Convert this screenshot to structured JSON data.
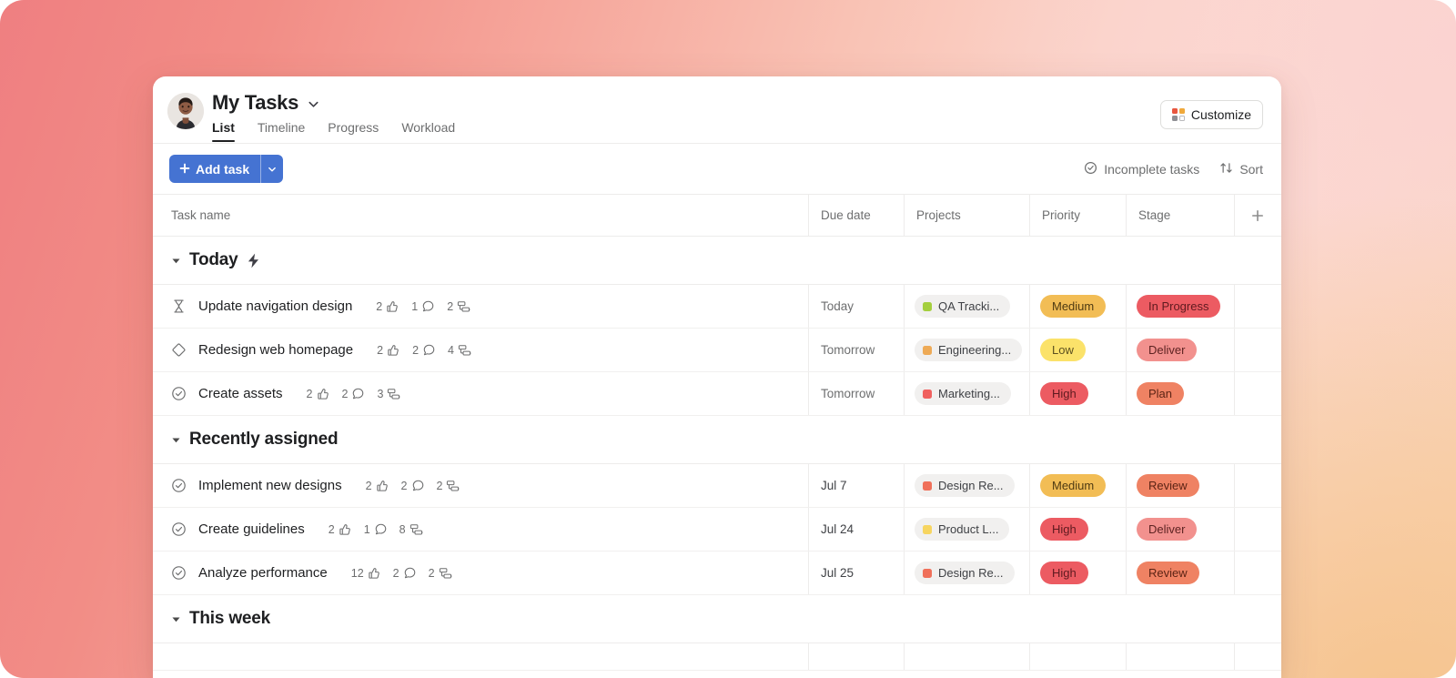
{
  "background": {
    "gradient_from": "#ef7f81",
    "gradient_mid": "#f9c3b5",
    "gradient_to": "#f9d7bd"
  },
  "header": {
    "title": "My Tasks",
    "title_caret_icon": "chevron-down-icon",
    "avatar_icon": "user-avatar",
    "tabs": [
      {
        "label": "List",
        "active": true
      },
      {
        "label": "Timeline",
        "active": false
      },
      {
        "label": "Progress",
        "active": false
      },
      {
        "label": "Workload",
        "active": false
      }
    ],
    "customize": {
      "label": "Customize",
      "icon": "grid-squares-icon",
      "swatches": [
        "#e8563f",
        "#f0a93b",
        "#8f8f94",
        "#ffffff"
      ]
    }
  },
  "toolbar": {
    "add_task_label": "Add task",
    "add_task_plus_icon": "plus-icon",
    "add_task_caret_icon": "chevron-down-icon",
    "add_task_color": "#4573d2",
    "filter": {
      "label": "Incomplete tasks",
      "icon": "check-circle-icon"
    },
    "sort": {
      "label": "Sort",
      "icon": "sort-arrows-icon"
    }
  },
  "table": {
    "columns": [
      {
        "key": "task_name",
        "label": "Task name"
      },
      {
        "key": "due_date",
        "label": "Due date"
      },
      {
        "key": "projects",
        "label": "Projects"
      },
      {
        "key": "priority",
        "label": "Priority"
      },
      {
        "key": "stage",
        "label": "Stage"
      }
    ],
    "add_column_icon": "plus-icon",
    "sections": [
      {
        "title": "Today",
        "caret_icon": "caret-down-icon",
        "badge_icon": "lightning-bolt-icon",
        "tasks": [
          {
            "status_icon": "hourglass-icon",
            "name": "Update navigation design",
            "likes": "2",
            "comments": "1",
            "subtasks": "2",
            "due_date": "Today",
            "due_muted": true,
            "project": {
              "label": "QA Tracki...",
              "color": "#a4cf3e"
            },
            "priority": {
              "label": "Medium",
              "bg": "#f2bd55",
              "fg": "#4e3a12"
            },
            "stage": {
              "label": "In Progress",
              "bg": "#ec5b62",
              "fg": "#5e1a1f"
            }
          },
          {
            "status_icon": "diamond-icon",
            "name": "Redesign web homepage",
            "likes": "2",
            "comments": "2",
            "subtasks": "4",
            "due_date": "Tomorrow",
            "due_muted": true,
            "project": {
              "label": "Engineering...",
              "color": "#eeaa56"
            },
            "priority": {
              "label": "Low",
              "bg": "#fbe26a",
              "fg": "#5c5020"
            },
            "stage": {
              "label": "Deliver",
              "bg": "#f2918e",
              "fg": "#5e2322"
            }
          },
          {
            "status_icon": "check-circle-icon",
            "name": "Create assets",
            "likes": "2",
            "comments": "2",
            "subtasks": "3",
            "due_date": "Tomorrow",
            "due_muted": true,
            "project": {
              "label": "Marketing...",
              "color": "#f0615f"
            },
            "priority": {
              "label": "High",
              "bg": "#ec5b62",
              "fg": "#5e1a1f"
            },
            "stage": {
              "label": "Plan",
              "bg": "#ef8263",
              "fg": "#5c2415"
            }
          }
        ]
      },
      {
        "title": "Recently assigned",
        "caret_icon": "caret-down-icon",
        "badge_icon": "",
        "tasks": [
          {
            "status_icon": "check-circle-icon",
            "name": "Implement new designs",
            "likes": "2",
            "comments": "2",
            "subtasks": "2",
            "due_date": "Jul 7",
            "due_muted": false,
            "project": {
              "label": "Design Re...",
              "color": "#f0705a"
            },
            "priority": {
              "label": "Medium",
              "bg": "#f2bd55",
              "fg": "#4e3a12"
            },
            "stage": {
              "label": "Review",
              "bg": "#ef8263",
              "fg": "#5c2415"
            }
          },
          {
            "status_icon": "check-circle-icon",
            "name": "Create guidelines",
            "likes": "2",
            "comments": "1",
            "subtasks": "8",
            "due_date": "Jul 24",
            "due_muted": false,
            "project": {
              "label": "Product L...",
              "color": "#f7d560"
            },
            "priority": {
              "label": "High",
              "bg": "#ec5b62",
              "fg": "#5e1a1f"
            },
            "stage": {
              "label": "Deliver",
              "bg": "#f2918e",
              "fg": "#5e2322"
            }
          },
          {
            "status_icon": "check-circle-icon",
            "name": "Analyze performance",
            "likes": "12",
            "comments": "2",
            "subtasks": "2",
            "due_date": "Jul 25",
            "due_muted": false,
            "project": {
              "label": "Design Re...",
              "color": "#f0705a"
            },
            "priority": {
              "label": "High",
              "bg": "#ec5b62",
              "fg": "#5e1a1f"
            },
            "stage": {
              "label": "Review",
              "bg": "#ef8263",
              "fg": "#5c2415"
            }
          }
        ]
      },
      {
        "title": "This week",
        "caret_icon": "caret-down-icon",
        "badge_icon": "",
        "tasks": []
      }
    ]
  }
}
